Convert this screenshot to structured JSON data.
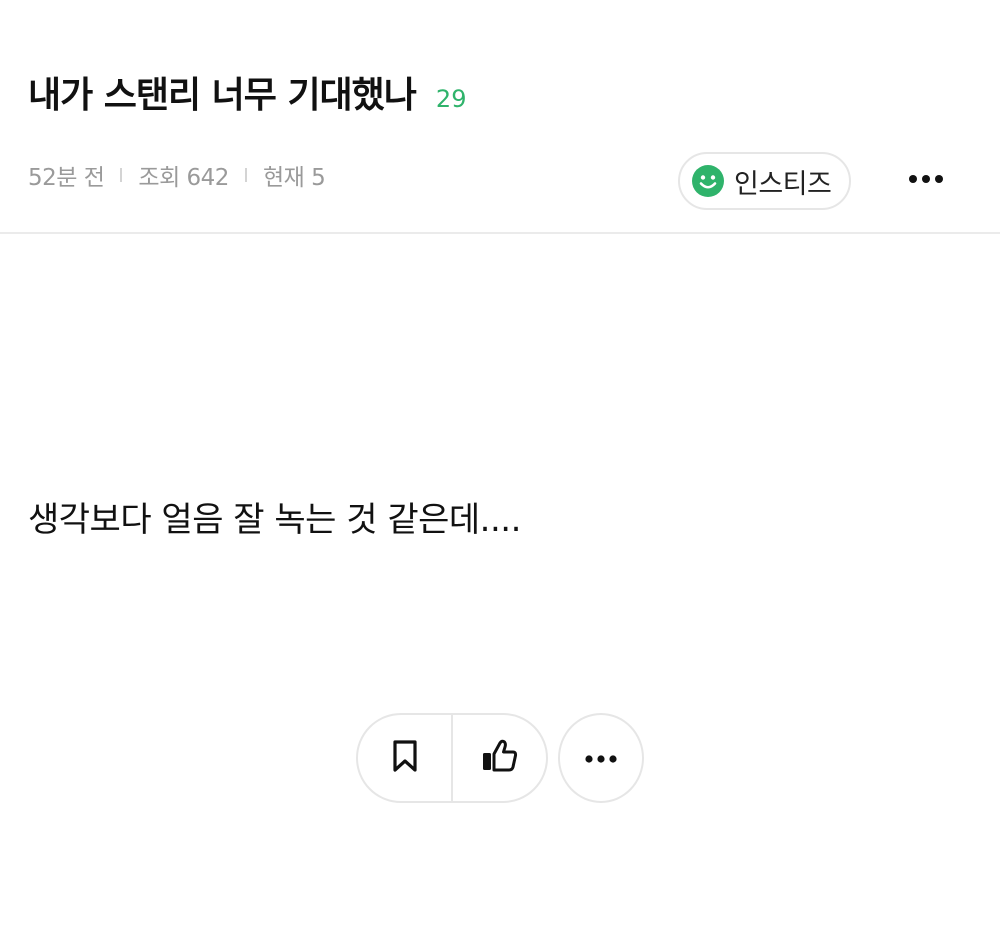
{
  "post": {
    "title": "내가 스탠리 너무 기대했나",
    "comment_count": "29",
    "meta": {
      "time": "52분 전",
      "views": "조회 642",
      "current": "현재 5"
    },
    "author": {
      "nickname": "인스티즈",
      "icon": "smile-icon"
    },
    "body": "생각보다 얼음 잘 녹는 것 같은데...."
  },
  "actions": {
    "icons": [
      "bookmark-icon",
      "thumbs-up-icon",
      "more-icon"
    ]
  },
  "colors": {
    "accent_green": "#2fb36b",
    "meta_gray": "#9a9a9a",
    "border": "#e6e6e6"
  }
}
